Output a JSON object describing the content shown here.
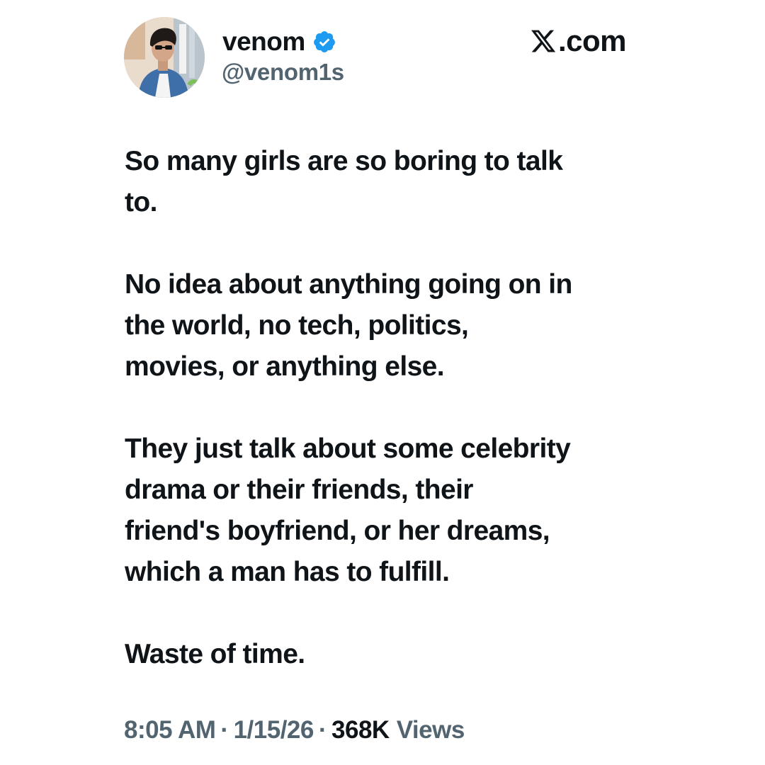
{
  "author": {
    "display_name": "venom",
    "handle": "@venom1s",
    "verified_icon": "verified-badge-icon",
    "verified_color": "#1d9bf0"
  },
  "brand": {
    "label": ".com",
    "icon": "x-logo-icon"
  },
  "tweet": {
    "paragraphs": [
      "So many girls are so boring to talk\nto.",
      "No idea about anything going on in\nthe world, no tech, politics,\nmovies, or anything else.",
      "They just talk about some celebrity\ndrama or their friends, their\nfriend's boyfriend, or her dreams,\nwhich a man has to fulfill.",
      "Waste of time."
    ]
  },
  "meta": {
    "time": "8:05 AM",
    "date": "1/15/26",
    "separator": "·",
    "views_count": "368K",
    "views_label": "Views"
  },
  "colors": {
    "text_primary": "#0f1419",
    "text_secondary": "#536471",
    "background": "#ffffff"
  }
}
